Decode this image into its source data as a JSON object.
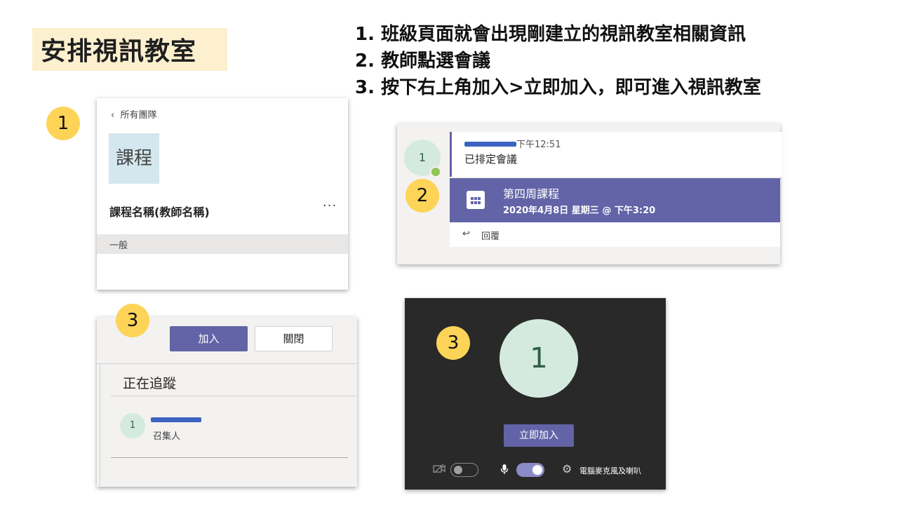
{
  "slide": {
    "title": "安排視訊教室",
    "steps": [
      "1. 班級頁面就會出現剛建立的視訊教室相關資訊",
      "2. 教師點選會議",
      "3. 按下右上角加入>立即加入，即可進入視訊教室"
    ],
    "badges": [
      "1",
      "2",
      "3",
      "3"
    ]
  },
  "team_panel": {
    "back_label": "所有團隊",
    "tile_text": "課程",
    "course_name": "課程名稱(教師名稱)",
    "more_label": "···",
    "channel": "一般"
  },
  "meeting_post": {
    "avatar_initial": "1",
    "time": "下午12:51",
    "status_text": "已排定會議",
    "meeting_title": "第四周課程",
    "meeting_datetime": "2020年4月8日 星期三 @ 下午3:20",
    "reply_label": "回覆"
  },
  "meeting_header": {
    "join_label": "加入",
    "close_label": "關閉",
    "following_label": "正在追蹤",
    "avatar_initial": "1",
    "organizer_label": "召集人"
  },
  "prejoin": {
    "avatar_initial": "1",
    "join_now_label": "立即加入",
    "audio_label": "電腦麥克風及喇叭",
    "camera_on": false,
    "mic_on": true
  },
  "colors": {
    "teams_purple": "#6264a7",
    "badge_yellow": "#fdd457",
    "title_highlight": "#fdf0cf"
  }
}
